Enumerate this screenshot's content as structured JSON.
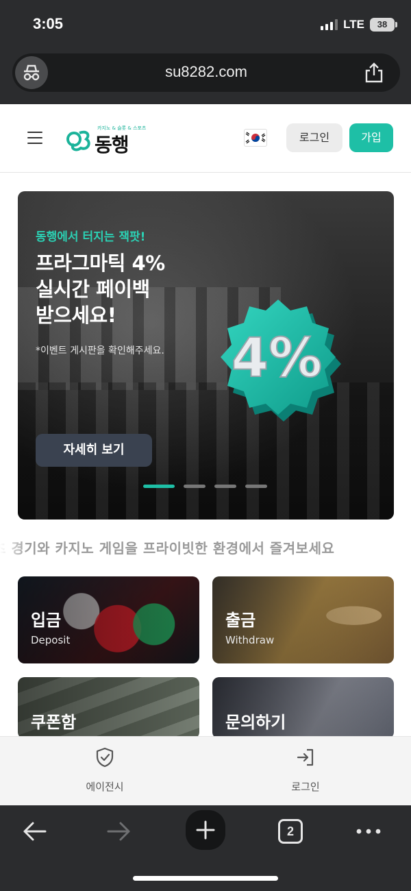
{
  "status_bar": {
    "time": "3:05",
    "network": "LTE",
    "battery": "38"
  },
  "browser": {
    "url": "su8282.com",
    "tab_count": "2",
    "icons": [
      "incognito-icon",
      "share-icon",
      "back-arrow-icon",
      "forward-arrow-icon",
      "plus-icon",
      "tabs-icon",
      "more-icon"
    ]
  },
  "header": {
    "logo_subtitle": "카지노 & 슬롯 & 스포츠",
    "logo_name": "동행",
    "login_label": "로그인",
    "signup_label": "가입",
    "accent": "#1ebfa6"
  },
  "hero": {
    "eyebrow": "동행에서 터지는 잭팟!",
    "title_line1": "프라그마틱 4%",
    "title_line2": "실시간 페이백",
    "title_line3": "받으세요!",
    "note": "*이벤트 게시판을 확인해주세요.",
    "badge_text": "4%",
    "cta_label": "자세히 보기",
    "slides_total": 4,
    "slide_active": 1
  },
  "marquee": {
    "text": "츠 경기와 카지노 게임을 프라이빗한 환경에서 즐겨보세요"
  },
  "tiles": [
    {
      "title": "입금",
      "subtitle": "Deposit"
    },
    {
      "title": "출금",
      "subtitle": "Withdraw"
    },
    {
      "title": "쿠폰함",
      "subtitle": ""
    },
    {
      "title": "문의하기",
      "subtitle": ""
    }
  ],
  "bottom_nav": [
    {
      "label": "에이전시",
      "icon": "shield-check-icon"
    },
    {
      "label": "로그인",
      "icon": "login-arrow-icon"
    }
  ]
}
